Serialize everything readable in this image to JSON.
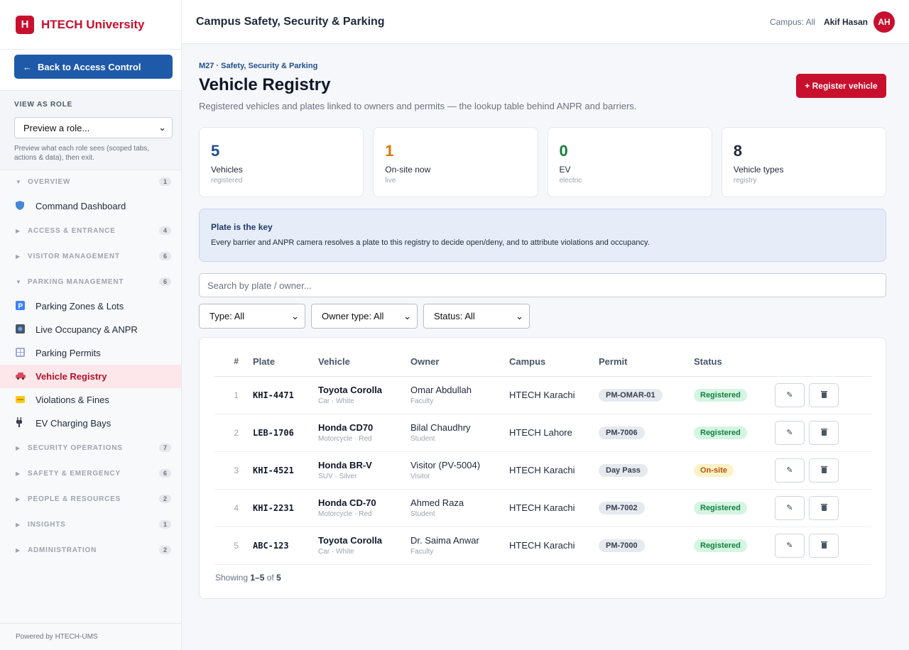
{
  "brand": {
    "logo": "H",
    "name": "HTECH University"
  },
  "sidebar": {
    "back_label": "Back to Access Control",
    "role_label": "VIEW AS ROLE",
    "role_select": "Preview a role...",
    "role_hint": "Preview what each role sees (scoped tabs, actions & data), then exit.",
    "overview": {
      "label": "OVERVIEW",
      "count": "1"
    },
    "command_dashboard": "Command Dashboard",
    "access": {
      "label": "ACCESS & ENTRANCE",
      "count": "4"
    },
    "visitor": {
      "label": "VISITOR MANAGEMENT",
      "count": "6"
    },
    "parking": {
      "label": "PARKING MANAGEMENT",
      "count": "6"
    },
    "parking_items": [
      "Parking Zones & Lots",
      "Live Occupancy & ANPR",
      "Parking Permits",
      "Vehicle Registry",
      "Violations & Fines",
      "EV Charging Bays"
    ],
    "security": {
      "label": "SECURITY OPERATIONS",
      "count": "7"
    },
    "safety": {
      "label": "SAFETY & EMERGENCY",
      "count": "6"
    },
    "people": {
      "label": "PEOPLE & RESOURCES",
      "count": "2"
    },
    "insights": {
      "label": "INSIGHTS",
      "count": "1"
    },
    "admin": {
      "label": "ADMINISTRATION",
      "count": "2"
    },
    "footer": "Powered by HTECH-UMS"
  },
  "topbar": {
    "title": "Campus Safety, Security & Parking",
    "campus": "Campus: All",
    "user": "Akif Hasan",
    "initials": "AH"
  },
  "page": {
    "crumb": "M27 · Safety, Security & Parking",
    "title": "Vehicle Registry",
    "subtitle": "Registered vehicles and plates linked to owners and permits — the lookup table behind ANPR and barriers.",
    "register_label": "+ Register vehicle"
  },
  "stats": [
    {
      "value": "5",
      "label": "Vehicles",
      "sub": "registered",
      "color": "#1f4e8c"
    },
    {
      "value": "1",
      "label": "On-site now",
      "sub": "live",
      "color": "#d97706"
    },
    {
      "value": "0",
      "label": "EV",
      "sub": "electric",
      "color": "#15803d"
    },
    {
      "value": "8",
      "label": "Vehicle types",
      "sub": "registry",
      "color": "#1e293b"
    }
  ],
  "info": {
    "heading": "Plate is the key",
    "body": "Every barrier and ANPR camera resolves a plate to this registry to decide open/deny, and to attribute violations and occupancy."
  },
  "search": {
    "placeholder": "Search by plate / owner..."
  },
  "filters": [
    "Type: All",
    "Owner type: All",
    "Status: All"
  ],
  "table": {
    "headers": [
      "#",
      "Plate",
      "Vehicle",
      "Owner",
      "Campus",
      "Permit",
      "Status"
    ],
    "rows": [
      {
        "n": "1",
        "plate": "KHI-4471",
        "vehicle": "Toyota Corolla",
        "vsub": "Car · White",
        "owner": "Omar Abdullah",
        "osub": "Faculty",
        "campus": "HTECH Karachi",
        "permit": "PM-OMAR-01",
        "status": "Registered"
      },
      {
        "n": "2",
        "plate": "LEB-1706",
        "vehicle": "Honda CD70",
        "vsub": "Motorcycle · Red",
        "owner": "Bilal Chaudhry",
        "osub": "Student",
        "campus": "HTECH Lahore",
        "permit": "PM-7006",
        "status": "Registered"
      },
      {
        "n": "3",
        "plate": "KHI-4521",
        "vehicle": "Honda BR-V",
        "vsub": "SUV · Silver",
        "owner": "Visitor (PV-5004)",
        "osub": "Visitor",
        "campus": "HTECH Karachi",
        "permit": "Day Pass",
        "status": "On-site"
      },
      {
        "n": "4",
        "plate": "KHI-2231",
        "vehicle": "Honda CD-70",
        "vsub": "Motorcycle · Red",
        "owner": "Ahmed Raza",
        "osub": "Student",
        "campus": "HTECH Karachi",
        "permit": "PM-7002",
        "status": "Registered"
      },
      {
        "n": "5",
        "plate": "ABC-123",
        "vehicle": "Toyota Corolla",
        "vsub": "Car · White",
        "owner": "Dr. Saima Anwar",
        "osub": "Faculty",
        "campus": "HTECH Karachi",
        "permit": "PM-7000",
        "status": "Registered"
      }
    ]
  },
  "pager": {
    "prefix": "Showing",
    "range": "1–5",
    "of": "of",
    "total": "5"
  },
  "colors": {
    "brand": "#c8102e",
    "accent": "#1f5aa8"
  }
}
